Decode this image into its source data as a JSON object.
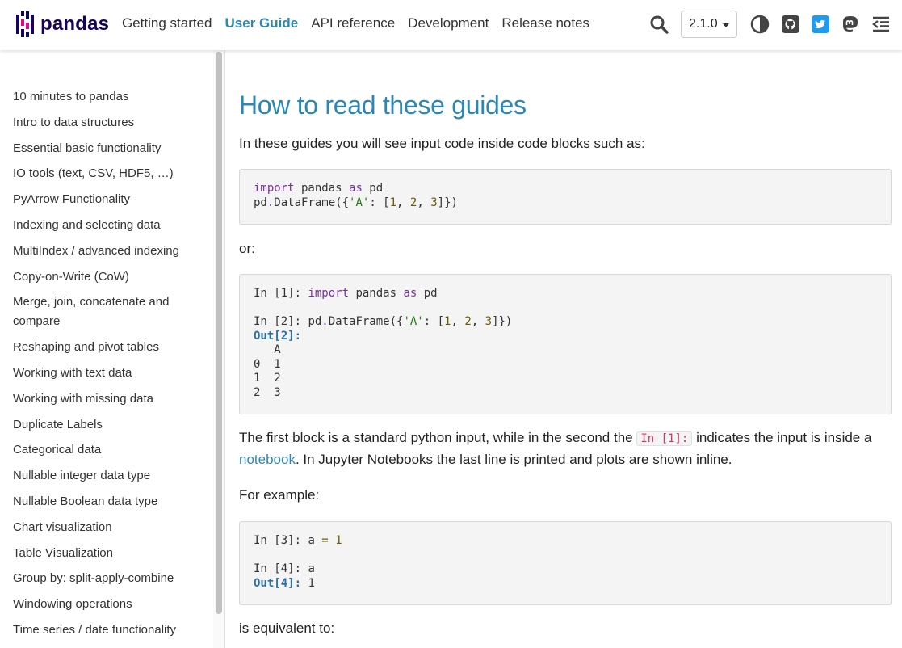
{
  "header": {
    "logo_text": "pandas",
    "nav": [
      "Getting started",
      "User Guide",
      "API reference",
      "Development",
      "Release notes"
    ],
    "active_nav": "User Guide",
    "version": "2.1.0",
    "icons": [
      "search-icon",
      "theme-toggle-icon",
      "github-icon",
      "twitter-icon",
      "mastodon-icon",
      "secondary-sidebar-toggle-icon"
    ],
    "accent_color": "#2c87b3",
    "brand_color": "#150458",
    "brand_pink": "#e70488"
  },
  "sidebar": {
    "items": [
      "10 minutes to pandas",
      "Intro to data structures",
      "Essential basic functionality",
      "IO tools (text, CSV, HDF5, …)",
      "PyArrow Functionality",
      "Indexing and selecting data",
      "MultiIndex / advanced indexing",
      "Copy-on-Write (CoW)",
      "Merge, join, concatenate and compare",
      "Reshaping and pivot tables",
      "Working with text data",
      "Working with missing data",
      "Duplicate Labels",
      "Categorical data",
      "Nullable integer data type",
      "Nullable Boolean data type",
      "Chart visualization",
      "Table Visualization",
      "Group by: split-apply-combine",
      "Windowing operations",
      "Time series / date functionality"
    ]
  },
  "main": {
    "title": "How to read these guides",
    "intro": "In these guides you will see input code inside code blocks such as:",
    "code1": {
      "line1_kw": "import",
      "line1_mod": " pandas ",
      "line1_as": "as",
      "line1_alias": " pd",
      "line2_pre": "pd",
      "line2_dot": ".",
      "line2_fn": "DataFrame({",
      "line2_key": "'A'",
      "line2_mid": ": [",
      "n1": "1",
      "sep": ", ",
      "n2": "2",
      "n3": "3",
      "line2_end": "]})"
    },
    "or_text": "or:",
    "code2": {
      "p1": "In [1]: ",
      "p2": "In [2]: ",
      "out2": "Out[2]:",
      "table": "   A\n0  1\n1  2\n2  3"
    },
    "para2_a": "The first block is a standard python input, while in the second the ",
    "para2_code": "In [1]:",
    "para2_b": " indicates the input is inside a ",
    "para2_link": "notebook",
    "para2_c": ". In Jupyter Notebooks the last line is printed and plots are shown inline.",
    "example_text": "For example:",
    "code3": {
      "p3": "In [3]: ",
      "a_var": "a ",
      "eq": "=",
      "one": " 1",
      "p4": "In [4]: ",
      "a_ref": "a",
      "out4": "Out[4]:",
      "out4_val": " 1"
    },
    "equiv_text": "is equivalent to:"
  }
}
